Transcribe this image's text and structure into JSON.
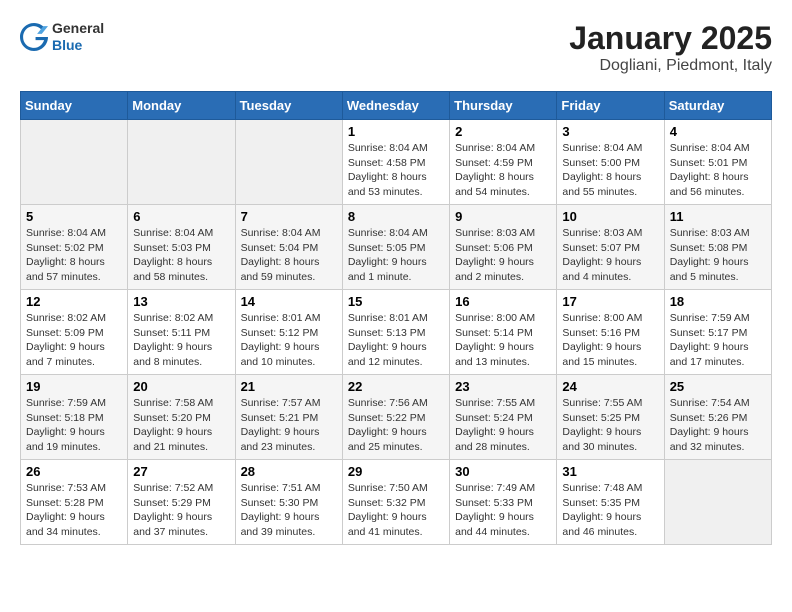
{
  "header": {
    "logo_general": "General",
    "logo_blue": "Blue",
    "title": "January 2025",
    "subtitle": "Dogliani, Piedmont, Italy"
  },
  "weekdays": [
    "Sunday",
    "Monday",
    "Tuesday",
    "Wednesday",
    "Thursday",
    "Friday",
    "Saturday"
  ],
  "weeks": [
    [
      {
        "day": "",
        "info": ""
      },
      {
        "day": "",
        "info": ""
      },
      {
        "day": "",
        "info": ""
      },
      {
        "day": "1",
        "info": "Sunrise: 8:04 AM\nSunset: 4:58 PM\nDaylight: 8 hours\nand 53 minutes."
      },
      {
        "day": "2",
        "info": "Sunrise: 8:04 AM\nSunset: 4:59 PM\nDaylight: 8 hours\nand 54 minutes."
      },
      {
        "day": "3",
        "info": "Sunrise: 8:04 AM\nSunset: 5:00 PM\nDaylight: 8 hours\nand 55 minutes."
      },
      {
        "day": "4",
        "info": "Sunrise: 8:04 AM\nSunset: 5:01 PM\nDaylight: 8 hours\nand 56 minutes."
      }
    ],
    [
      {
        "day": "5",
        "info": "Sunrise: 8:04 AM\nSunset: 5:02 PM\nDaylight: 8 hours\nand 57 minutes."
      },
      {
        "day": "6",
        "info": "Sunrise: 8:04 AM\nSunset: 5:03 PM\nDaylight: 8 hours\nand 58 minutes."
      },
      {
        "day": "7",
        "info": "Sunrise: 8:04 AM\nSunset: 5:04 PM\nDaylight: 8 hours\nand 59 minutes."
      },
      {
        "day": "8",
        "info": "Sunrise: 8:04 AM\nSunset: 5:05 PM\nDaylight: 9 hours\nand 1 minute."
      },
      {
        "day": "9",
        "info": "Sunrise: 8:03 AM\nSunset: 5:06 PM\nDaylight: 9 hours\nand 2 minutes."
      },
      {
        "day": "10",
        "info": "Sunrise: 8:03 AM\nSunset: 5:07 PM\nDaylight: 9 hours\nand 4 minutes."
      },
      {
        "day": "11",
        "info": "Sunrise: 8:03 AM\nSunset: 5:08 PM\nDaylight: 9 hours\nand 5 minutes."
      }
    ],
    [
      {
        "day": "12",
        "info": "Sunrise: 8:02 AM\nSunset: 5:09 PM\nDaylight: 9 hours\nand 7 minutes."
      },
      {
        "day": "13",
        "info": "Sunrise: 8:02 AM\nSunset: 5:11 PM\nDaylight: 9 hours\nand 8 minutes."
      },
      {
        "day": "14",
        "info": "Sunrise: 8:01 AM\nSunset: 5:12 PM\nDaylight: 9 hours\nand 10 minutes."
      },
      {
        "day": "15",
        "info": "Sunrise: 8:01 AM\nSunset: 5:13 PM\nDaylight: 9 hours\nand 12 minutes."
      },
      {
        "day": "16",
        "info": "Sunrise: 8:00 AM\nSunset: 5:14 PM\nDaylight: 9 hours\nand 13 minutes."
      },
      {
        "day": "17",
        "info": "Sunrise: 8:00 AM\nSunset: 5:16 PM\nDaylight: 9 hours\nand 15 minutes."
      },
      {
        "day": "18",
        "info": "Sunrise: 7:59 AM\nSunset: 5:17 PM\nDaylight: 9 hours\nand 17 minutes."
      }
    ],
    [
      {
        "day": "19",
        "info": "Sunrise: 7:59 AM\nSunset: 5:18 PM\nDaylight: 9 hours\nand 19 minutes."
      },
      {
        "day": "20",
        "info": "Sunrise: 7:58 AM\nSunset: 5:20 PM\nDaylight: 9 hours\nand 21 minutes."
      },
      {
        "day": "21",
        "info": "Sunrise: 7:57 AM\nSunset: 5:21 PM\nDaylight: 9 hours\nand 23 minutes."
      },
      {
        "day": "22",
        "info": "Sunrise: 7:56 AM\nSunset: 5:22 PM\nDaylight: 9 hours\nand 25 minutes."
      },
      {
        "day": "23",
        "info": "Sunrise: 7:55 AM\nSunset: 5:24 PM\nDaylight: 9 hours\nand 28 minutes."
      },
      {
        "day": "24",
        "info": "Sunrise: 7:55 AM\nSunset: 5:25 PM\nDaylight: 9 hours\nand 30 minutes."
      },
      {
        "day": "25",
        "info": "Sunrise: 7:54 AM\nSunset: 5:26 PM\nDaylight: 9 hours\nand 32 minutes."
      }
    ],
    [
      {
        "day": "26",
        "info": "Sunrise: 7:53 AM\nSunset: 5:28 PM\nDaylight: 9 hours\nand 34 minutes."
      },
      {
        "day": "27",
        "info": "Sunrise: 7:52 AM\nSunset: 5:29 PM\nDaylight: 9 hours\nand 37 minutes."
      },
      {
        "day": "28",
        "info": "Sunrise: 7:51 AM\nSunset: 5:30 PM\nDaylight: 9 hours\nand 39 minutes."
      },
      {
        "day": "29",
        "info": "Sunrise: 7:50 AM\nSunset: 5:32 PM\nDaylight: 9 hours\nand 41 minutes."
      },
      {
        "day": "30",
        "info": "Sunrise: 7:49 AM\nSunset: 5:33 PM\nDaylight: 9 hours\nand 44 minutes."
      },
      {
        "day": "31",
        "info": "Sunrise: 7:48 AM\nSunset: 5:35 PM\nDaylight: 9 hours\nand 46 minutes."
      },
      {
        "day": "",
        "info": ""
      }
    ]
  ]
}
